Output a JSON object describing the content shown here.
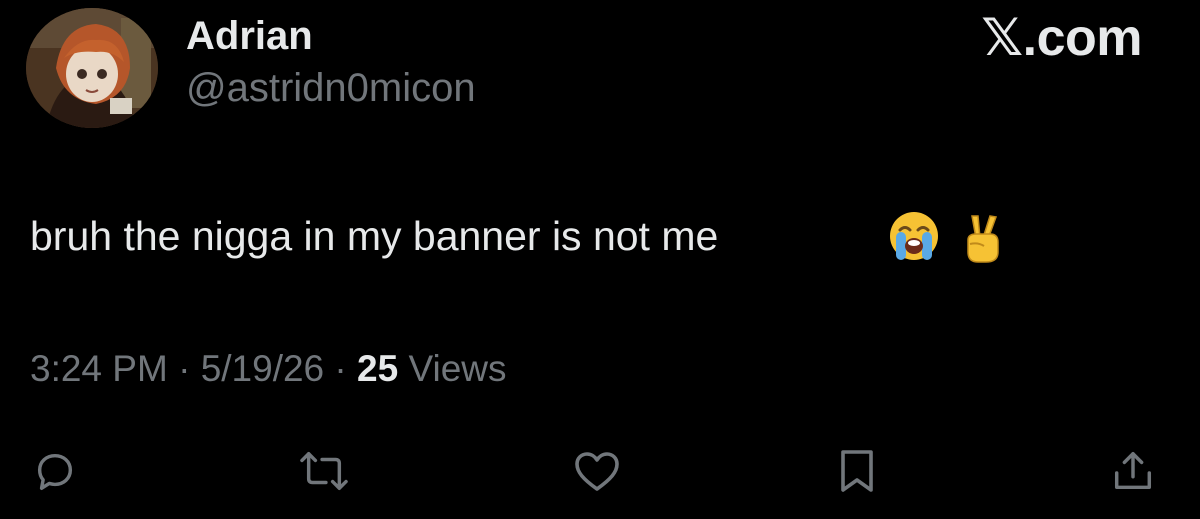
{
  "author": {
    "display_name": "Adrian",
    "handle": "@astridn0micon",
    "avatar_icon": "anime-character-avatar"
  },
  "brand": "𝕏.com",
  "tweet": {
    "text": "bruh the nigga in my banner is not me",
    "emojis": [
      "loudly-crying-face-emoji",
      "victory-hand-emoji"
    ]
  },
  "meta": {
    "time": "3:24 PM",
    "separator": "·",
    "date": "5/19/26",
    "views_count": "25",
    "views_label": "Views"
  },
  "actions": [
    {
      "icon": "reply-icon"
    },
    {
      "icon": "retweet-icon"
    },
    {
      "icon": "like-icon"
    },
    {
      "icon": "bookmark-icon"
    },
    {
      "icon": "share-icon"
    }
  ],
  "colors": {
    "background": "#000000",
    "primary_text": "#e7e9ea",
    "secondary_text": "#71767b",
    "emoji_yellow": "#f6c234",
    "emoji_tear_blue": "#5aa9e6"
  }
}
